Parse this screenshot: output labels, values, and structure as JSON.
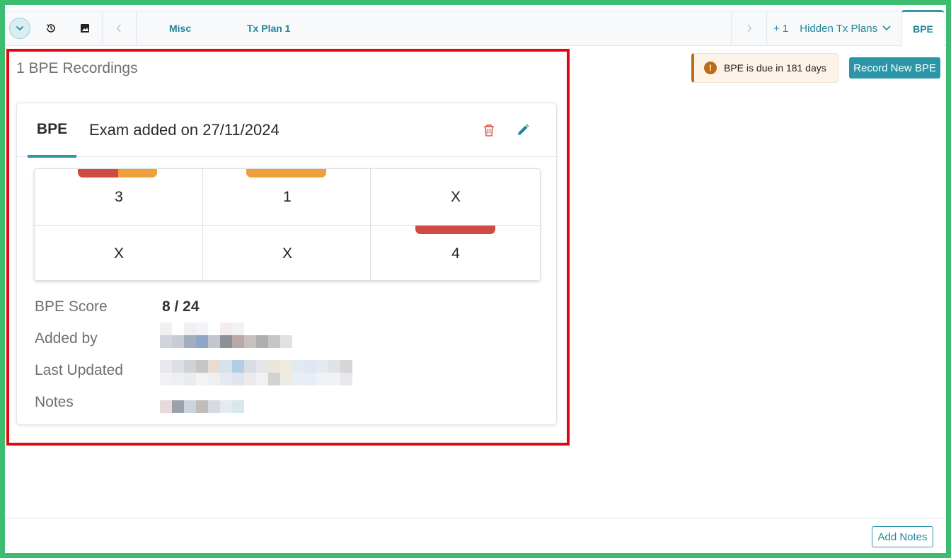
{
  "tabs": {
    "items": [
      {
        "label": "Misc"
      },
      {
        "label": "Tx Plan 1"
      }
    ],
    "hidden_count": "+ 1",
    "hidden_label": "Hidden Tx Plans",
    "active_tab": "BPE"
  },
  "recordings_title": "1 BPE Recordings",
  "due": {
    "text": "BPE is due in 181 days",
    "icon": "!"
  },
  "record_button": "Record New BPE",
  "card": {
    "tab": "BPE",
    "subtitle": "Exam added on 27/11/2024",
    "grid": {
      "top": [
        "3",
        "1",
        "X"
      ],
      "bottom": [
        "X",
        "X",
        "4"
      ]
    },
    "fields": {
      "score_label": "BPE Score",
      "score_value": "8 / 24",
      "added_by_label": "Added by",
      "last_updated_label": "Last Updated",
      "notes_label": "Notes"
    }
  },
  "footer": {
    "add_notes": "Add Notes"
  },
  "colors": {
    "accent": "#2a96a8",
    "marker_red": "#d14b45",
    "marker_orange": "#f0a03a",
    "warning": "#c06a16",
    "highlight": "#e0070e"
  }
}
